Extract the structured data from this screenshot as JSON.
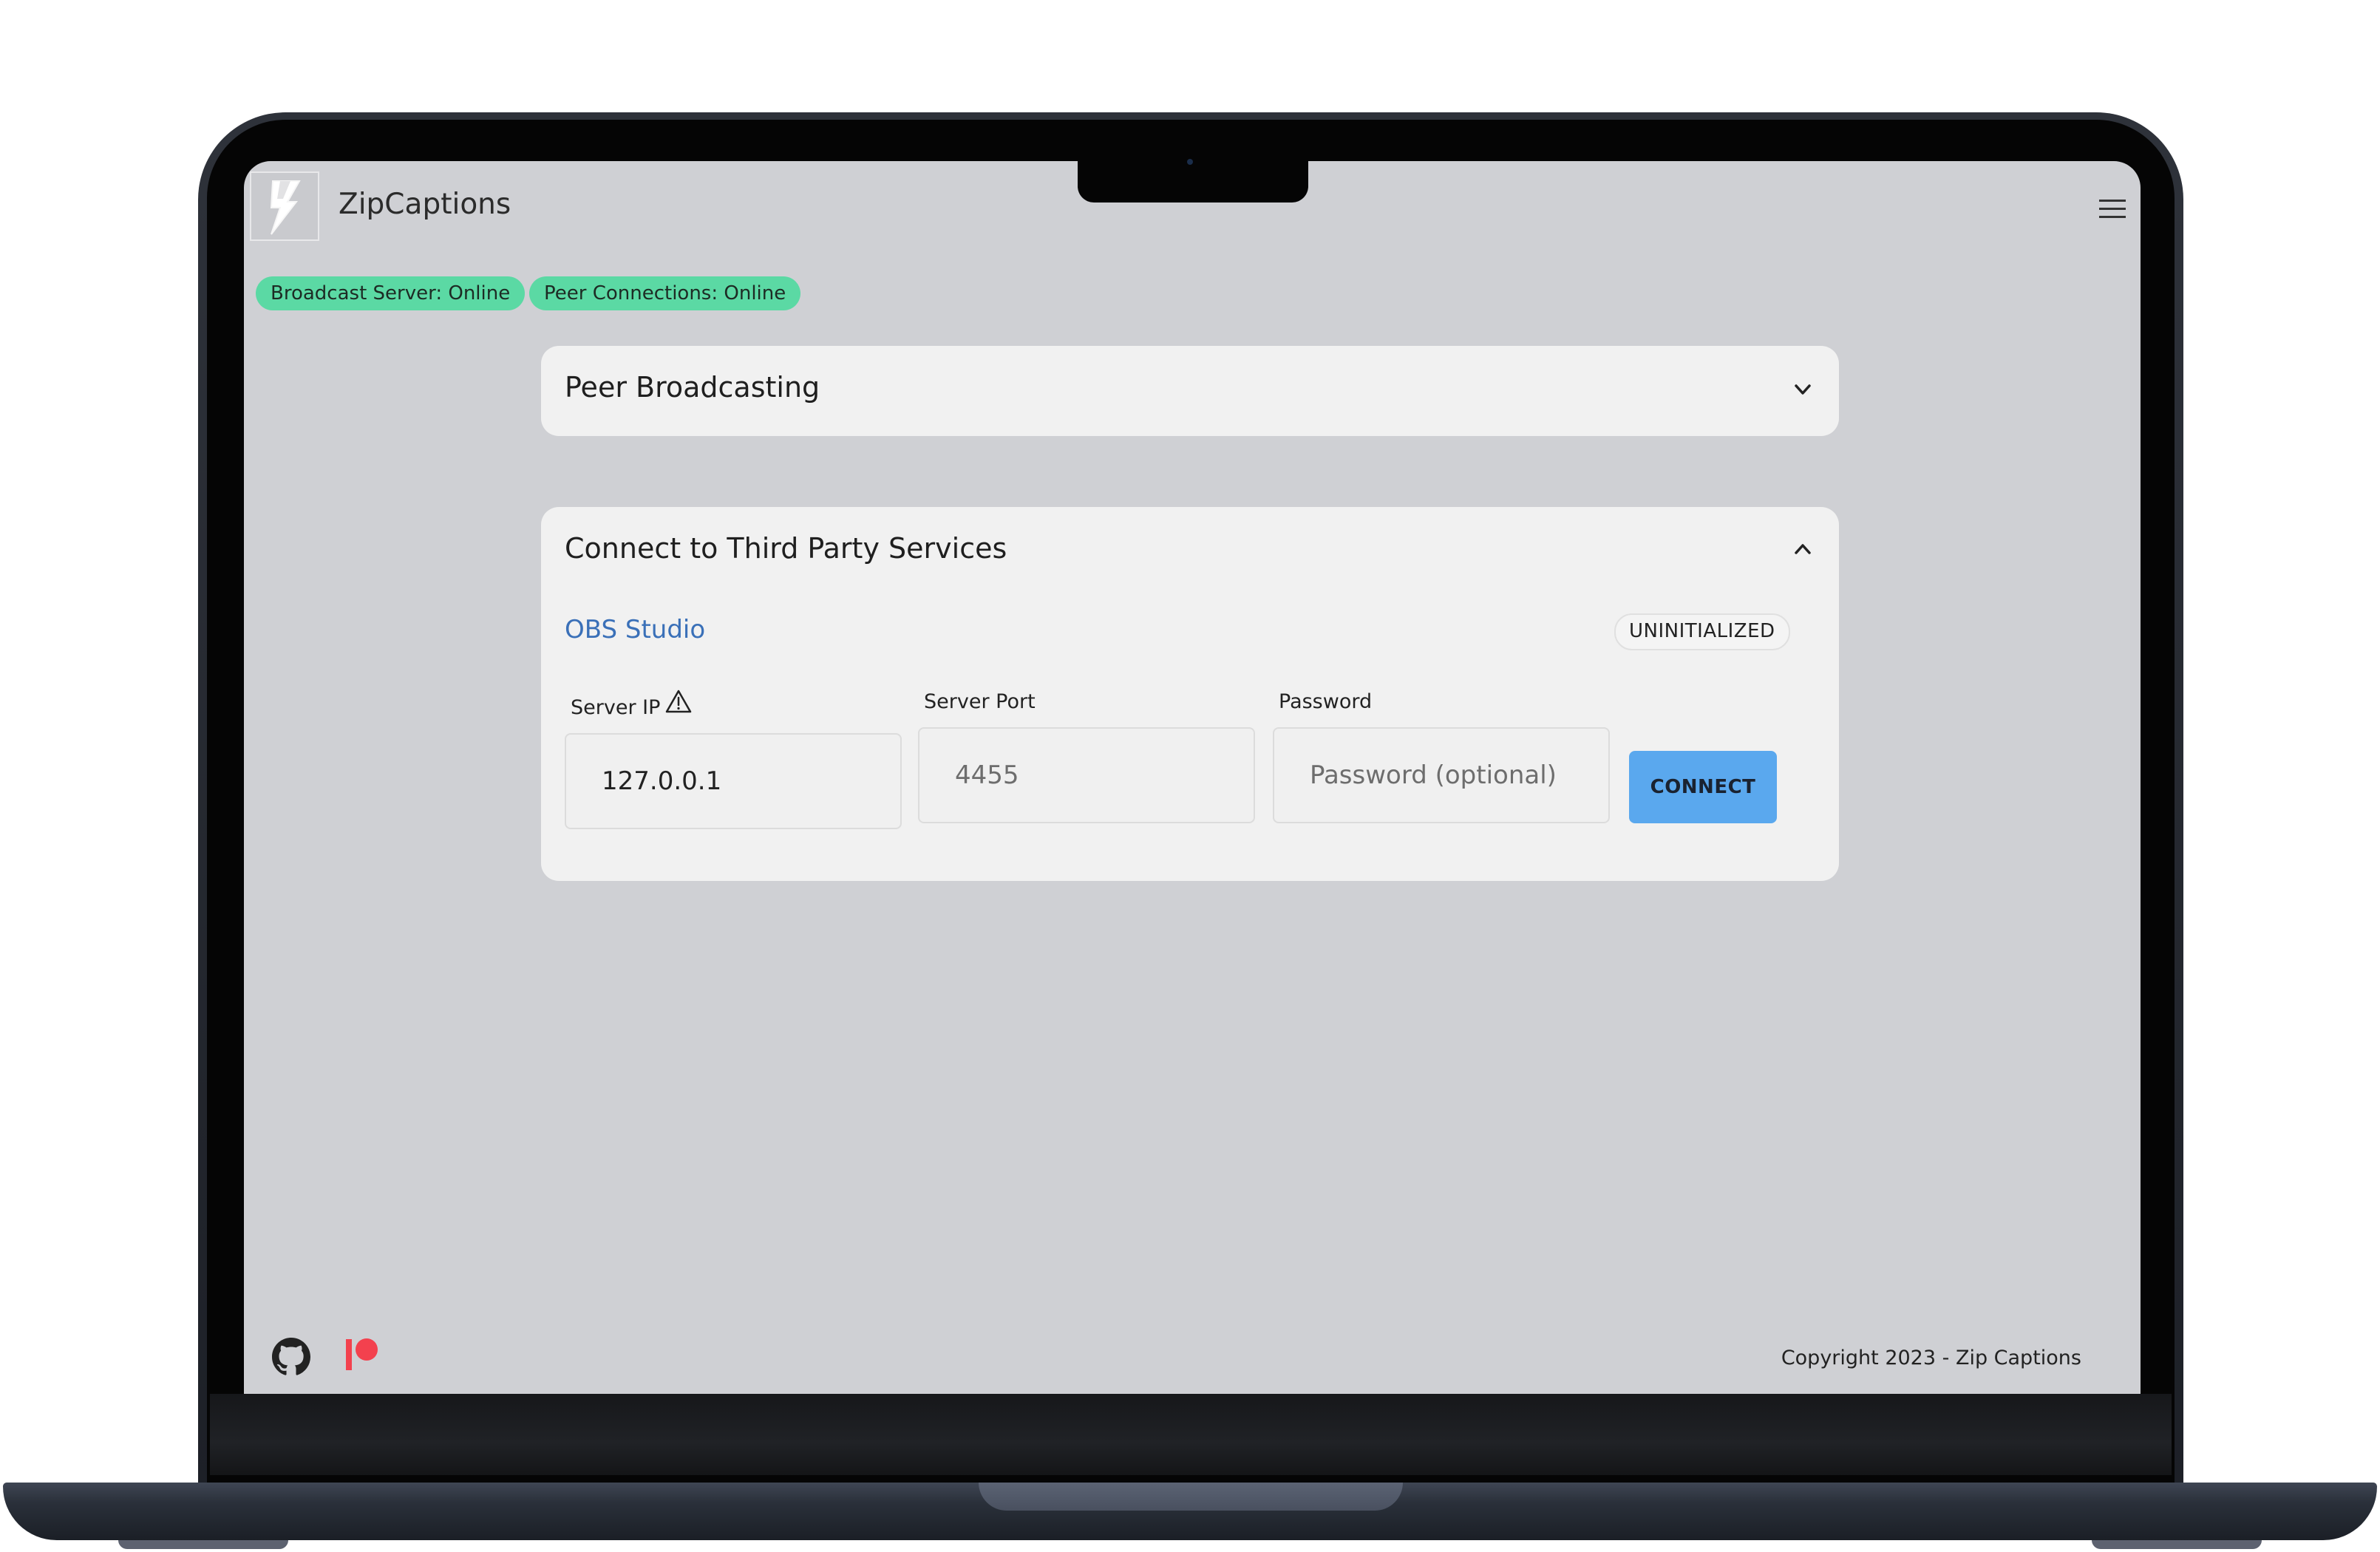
{
  "app": {
    "title": "ZipCaptions",
    "logo_icon": "lightning-bolt-icon",
    "menu_icon": "hamburger-menu-icon"
  },
  "status": {
    "broadcast": "Broadcast Server: Online",
    "peer": "Peer Connections: Online",
    "online_color": "#5bd9a4"
  },
  "peer_broadcasting": {
    "title": "Peer Broadcasting",
    "expanded": false
  },
  "third_party": {
    "title": "Connect to Third Party Services",
    "expanded": true,
    "service": {
      "name": "OBS Studio",
      "status": "UNINITIALIZED",
      "fields": {
        "ip_label": "Server IP",
        "ip_value": "127.0.0.1",
        "port_label": "Server Port",
        "port_placeholder": "4455",
        "password_label": "Password",
        "password_placeholder": "Password (optional)"
      },
      "connect_label": "CONNECT"
    }
  },
  "footer": {
    "copyright": "Copyright 2023 - Zip Captions",
    "github_icon": "github-icon",
    "patreon_icon": "patreon-icon",
    "patreon_color": "#f3414e"
  },
  "colors": {
    "accent": "#5aa8ee",
    "link": "#3a70b8",
    "screen_bg": "#cfd0d4",
    "card_bg": "#f1f1f1"
  }
}
